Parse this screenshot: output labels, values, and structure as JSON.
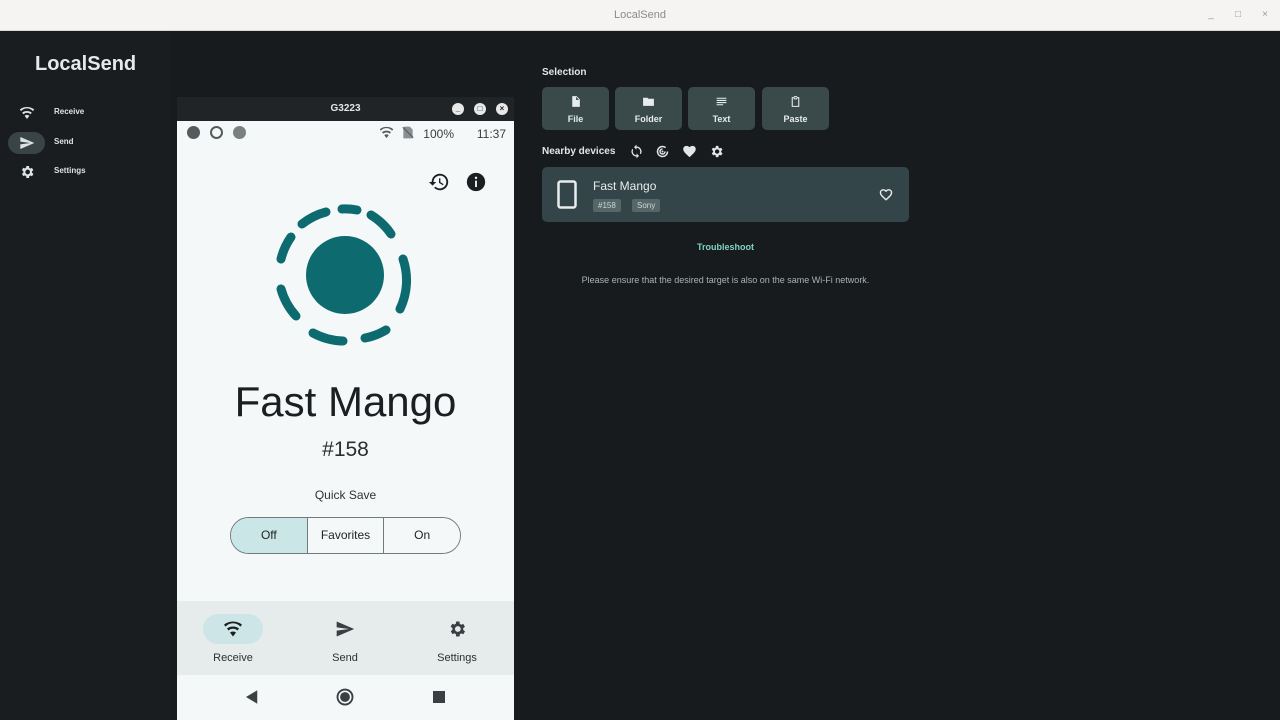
{
  "window": {
    "title": "LocalSend",
    "minimize": "_",
    "maximize": "□",
    "close": "×"
  },
  "sidebar": {
    "app_title": "LocalSend",
    "items": [
      {
        "label": "Receive",
        "icon": "wifi-icon",
        "active": false
      },
      {
        "label": "Send",
        "icon": "send-icon",
        "active": true
      },
      {
        "label": "Settings",
        "icon": "gear-icon",
        "active": false
      }
    ]
  },
  "main": {
    "selection_title": "Selection",
    "selection_buttons": [
      {
        "label": "File",
        "icon": "file-icon"
      },
      {
        "label": "Folder",
        "icon": "folder-icon"
      },
      {
        "label": "Text",
        "icon": "text-icon"
      },
      {
        "label": "Paste",
        "icon": "clipboard-icon"
      }
    ],
    "nearby_title": "Nearby devices",
    "nearby_icons": [
      "refresh-icon",
      "scan-icon",
      "heart-icon",
      "gear-icon"
    ],
    "device": {
      "name": "Fast Mango",
      "tags": [
        "#158",
        "Sony"
      ],
      "icon": "smartphone-icon"
    },
    "troubleshoot": "Troubleshoot",
    "hint": "Please ensure that the desired target is also on the same Wi-Fi network."
  },
  "emulator": {
    "title": "G3223",
    "status": {
      "battery": "100%",
      "time": "11:37"
    },
    "device_name": "Fast Mango",
    "device_number": "#158",
    "quick_save_label": "Quick Save",
    "quick_save_options": [
      "Off",
      "Favorites",
      "On"
    ],
    "quick_save_selected": "Off",
    "bottom_nav": [
      {
        "label": "Receive",
        "icon": "wifi-icon",
        "active": true
      },
      {
        "label": "Send",
        "icon": "send-icon",
        "active": false
      },
      {
        "label": "Settings",
        "icon": "gear-icon",
        "active": false
      }
    ]
  },
  "colors": {
    "accent": "#0d6b70",
    "card": "#34454a",
    "button": "#3a4a4a",
    "link": "#7fd3c4"
  }
}
